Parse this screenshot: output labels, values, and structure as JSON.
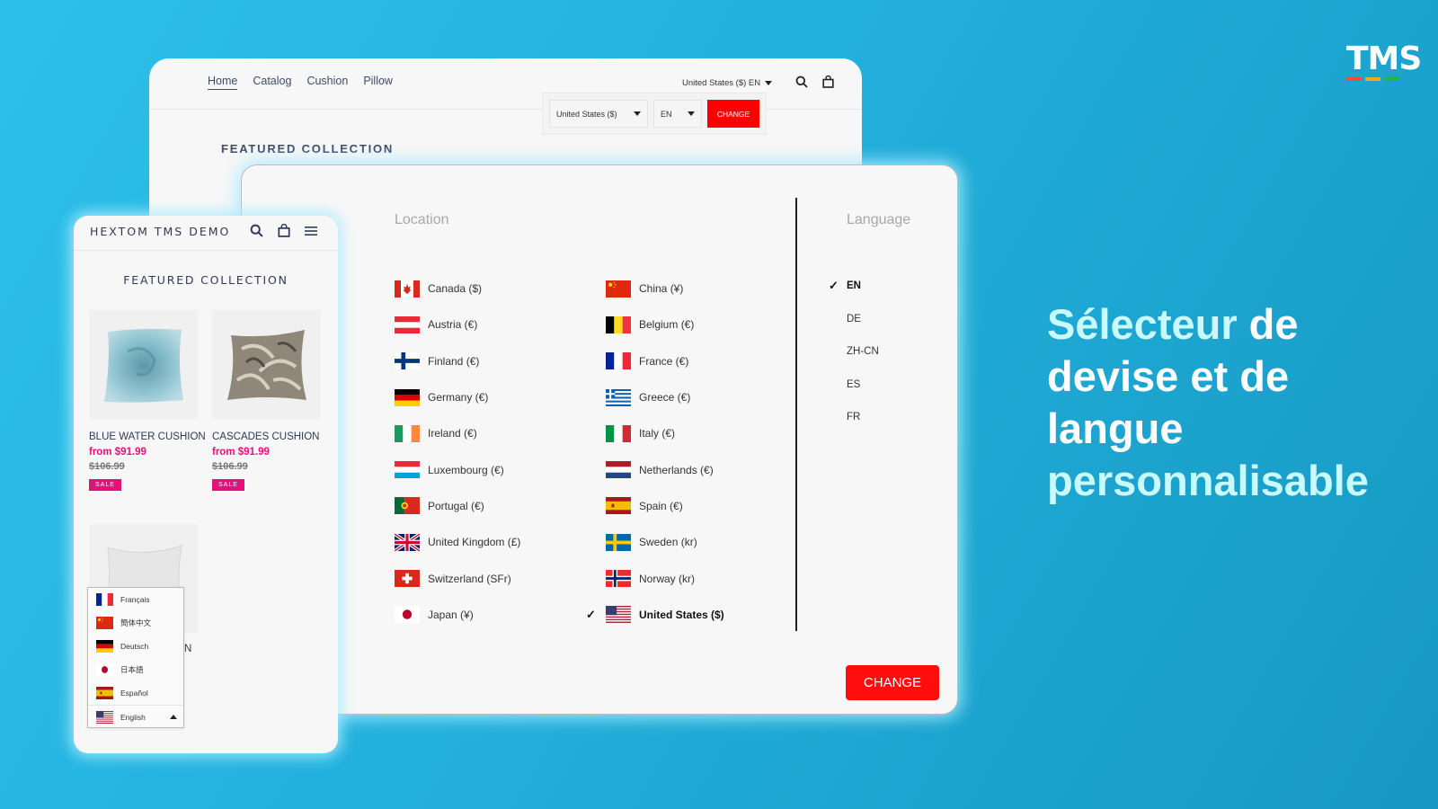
{
  "desktop": {
    "nav": [
      "Home",
      "Catalog",
      "Cushion",
      "Pillow"
    ],
    "active_nav": "Home",
    "header_selector": "United States ($) EN",
    "mini_panel": {
      "country_value": "United States ($)",
      "language_value": "EN",
      "change_label": "CHANGE"
    },
    "featured_title": "FEATURED COLLECTION"
  },
  "modal": {
    "location_title": "Location",
    "language_title": "Language",
    "countries_col1": [
      {
        "name": "Canada ($)",
        "flag": "ca"
      },
      {
        "name": "Austria (€)",
        "flag": "at"
      },
      {
        "name": "Finland (€)",
        "flag": "fi"
      },
      {
        "name": "Germany (€)",
        "flag": "de"
      },
      {
        "name": "Ireland (€)",
        "flag": "ie"
      },
      {
        "name": "Luxembourg (€)",
        "flag": "lu"
      },
      {
        "name": "Portugal (€)",
        "flag": "pt"
      },
      {
        "name": "United Kingdom (£)",
        "flag": "gb"
      },
      {
        "name": "Switzerland (SFr)",
        "flag": "ch"
      },
      {
        "name": "Japan (¥)",
        "flag": "jp"
      }
    ],
    "countries_col2": [
      {
        "name": "China (¥)",
        "flag": "cn"
      },
      {
        "name": "Belgium (€)",
        "flag": "be"
      },
      {
        "name": "France (€)",
        "flag": "fr"
      },
      {
        "name": "Greece (€)",
        "flag": "gr"
      },
      {
        "name": "Italy (€)",
        "flag": "it"
      },
      {
        "name": "Netherlands (€)",
        "flag": "nl"
      },
      {
        "name": "Spain (€)",
        "flag": "es"
      },
      {
        "name": "Sweden (kr)",
        "flag": "se"
      },
      {
        "name": "Norway (kr)",
        "flag": "no"
      },
      {
        "name": "United States ($)",
        "flag": "us",
        "selected": true
      }
    ],
    "languages": [
      {
        "code": "EN",
        "selected": true
      },
      {
        "code": "DE"
      },
      {
        "code": "ZH-CN"
      },
      {
        "code": "ES"
      },
      {
        "code": "FR"
      }
    ],
    "check_mark": "✓",
    "change_label": "CHANGE"
  },
  "mobile": {
    "brand": "HEXTOM TMS DEMO",
    "featured_title": "FEATURED COLLECTION",
    "products": [
      {
        "name": "BLUE WATER CUSHION",
        "price": "from $91.99",
        "old_price": "$106.99",
        "badge": "SALE"
      },
      {
        "name": "CASCADES CUSHION",
        "price": "from $91.99",
        "old_price": "$106.99",
        "badge": "SALE"
      }
    ],
    "partial_product_name_tail": "N",
    "language_dropdown": {
      "options": [
        {
          "label": "Français",
          "flag": "fr"
        },
        {
          "label": "簡体中文",
          "flag": "cn"
        },
        {
          "label": "Deutsch",
          "flag": "de"
        },
        {
          "label": "日本語",
          "flag": "jp"
        },
        {
          "label": "Español",
          "flag": "es"
        }
      ],
      "current": {
        "label": "English",
        "flag": "us"
      }
    }
  },
  "tagline": {
    "line1_highlight": "Sélecteur",
    "line1_rest": " de",
    "line2": "devise et de",
    "line3": "langue",
    "line4_highlight": "personnalisable"
  },
  "logo": {
    "text": "TMS",
    "bar_colors": [
      "#e8503a",
      "#f4a418",
      "#22b24c"
    ]
  },
  "colors": {
    "accent_red": "#ff0d0d",
    "sale_pink": "#e4117a",
    "nav_text": "#3d4b6a"
  }
}
